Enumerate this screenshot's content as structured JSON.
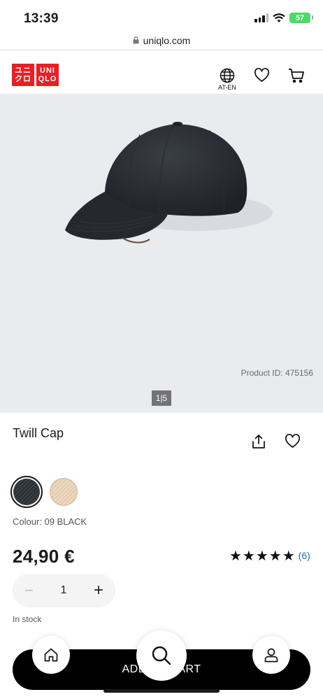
{
  "status_bar": {
    "time": "13:39",
    "battery": "57"
  },
  "browser": {
    "url": "uniqlo.com"
  },
  "header": {
    "logo_top": "ユニ",
    "logo_bottom": "クロ",
    "logo_en_top": "UNI",
    "logo_en_bottom": "QLO",
    "language": "AT-EN"
  },
  "product": {
    "name": "Twill Cap",
    "product_id": "Product ID: 475156",
    "image_pager": "1|5",
    "colours": [
      {
        "name": "09 BLACK",
        "hex": "#2f3339",
        "selected": true
      },
      {
        "name": "beige",
        "hex": "#e8d1b4",
        "selected": false
      }
    ],
    "colour_label": "Colour: 09 BLACK",
    "price": "24,90 €",
    "stars": "★★★★★",
    "rating_value": 5,
    "review_count": "(6)",
    "quantity": "1",
    "stock_status": "In stock"
  },
  "actions": {
    "add_to_cart": "ADD TO CART"
  },
  "colors": {
    "brand_red": "#ed1d24",
    "link_blue": "#1d6fb8"
  }
}
